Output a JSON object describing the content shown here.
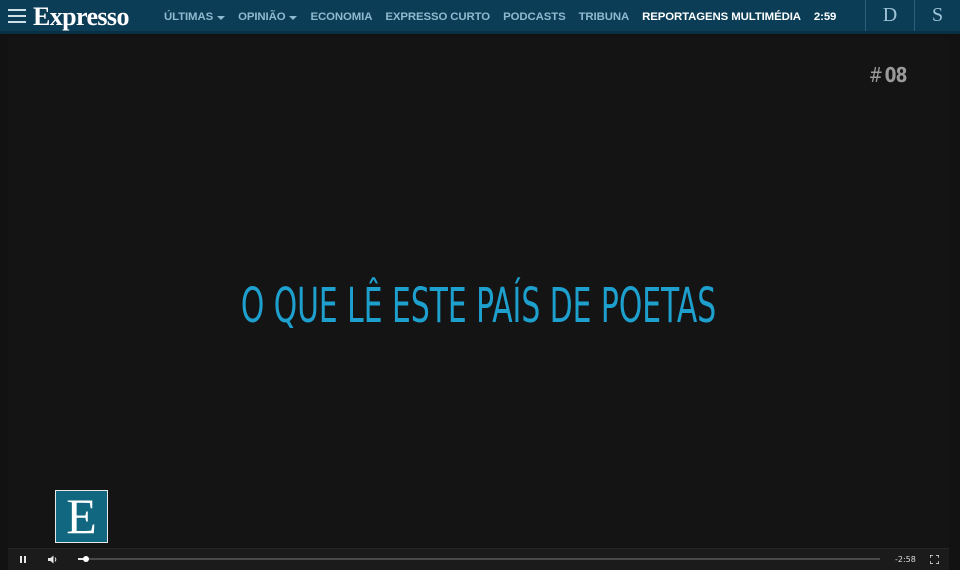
{
  "header": {
    "menu_icon": "hamburger-icon",
    "logo": "Expresso",
    "nav": [
      {
        "label": "ÚLTIMAS",
        "dropdown": true
      },
      {
        "label": "OPINIÃO",
        "dropdown": true
      },
      {
        "label": "ECONOMIA",
        "dropdown": false
      },
      {
        "label": "EXPRESSO CURTO",
        "dropdown": false
      },
      {
        "label": "PODCASTS",
        "dropdown": false
      },
      {
        "label": "TRIBUNA",
        "dropdown": false
      },
      {
        "label": "REPORTAGENS MULTIMÉDIA",
        "dropdown": false,
        "active": true
      }
    ],
    "time": "2:59",
    "brand_links": [
      "D",
      "S"
    ],
    "colors": {
      "bar": "#0b3d57",
      "nav_text": "#8fb9cf",
      "active": "#ffffff"
    }
  },
  "video": {
    "episode": {
      "hash": "#",
      "number": "08"
    },
    "headline": "O QUE LÊ ESTE PAÍS DE POETAS",
    "headline_color": "#1ea0cf",
    "watermark_letter": "E",
    "controls": {
      "play_state": "pause-icon",
      "volume_icon": "volume-icon",
      "progress": 0.01,
      "remaining": "-2:58",
      "fullscreen_icon": "fullscreen-icon"
    }
  }
}
